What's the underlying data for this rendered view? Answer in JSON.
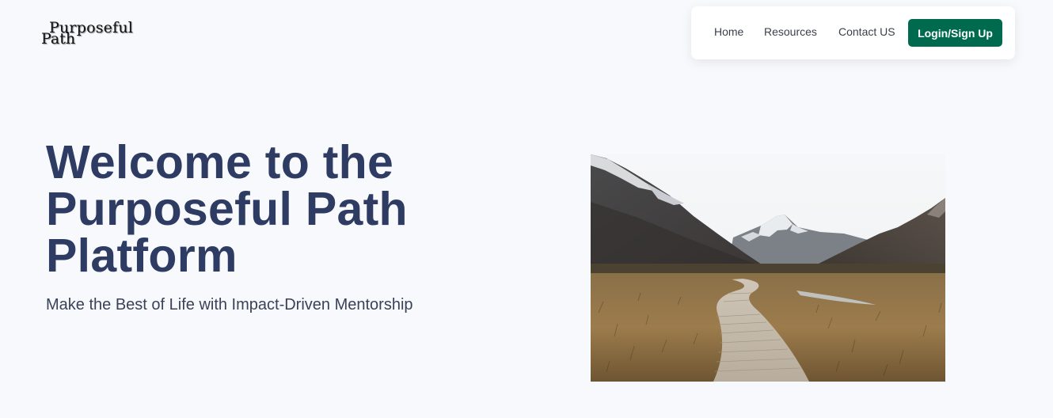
{
  "logo": {
    "line1": "Purposeful",
    "line2": "Path"
  },
  "nav": {
    "home": "Home",
    "resources": "Resources",
    "contact": "Contact US",
    "login": "Login/Sign Up"
  },
  "hero": {
    "title": "Welcome to the Purposeful Path Platform",
    "subtitle": "Make the Best of Life with Impact-Driven Mentorship",
    "image_icon": "mountain-boardwalk-photo"
  },
  "colors": {
    "brand_green": "#006a4e",
    "title_navy": "#2e3c63",
    "background": "#f8f9fc"
  }
}
